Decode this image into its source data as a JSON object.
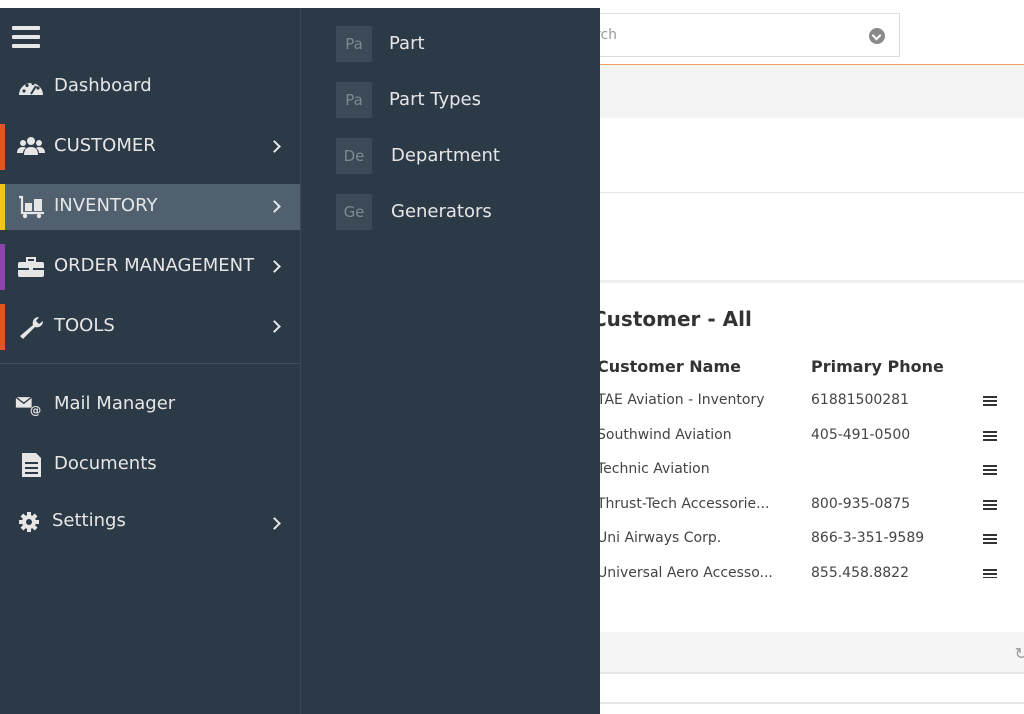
{
  "search": {
    "placeholder": "rch"
  },
  "panel": {
    "title": "Customer - All",
    "columns": [
      "Customer Name",
      "Primary Phone"
    ],
    "rows": [
      {
        "name": "TAE Aviation - Inventory",
        "phone": "61881500281"
      },
      {
        "name": "Southwind Aviation",
        "phone": "405-491-0500"
      },
      {
        "name": "Technic Aviation",
        "phone": ""
      },
      {
        "name": "Thrust-Tech Accessorie...",
        "phone": "800-935-0875"
      },
      {
        "name": "Uni Airways Corp.",
        "phone": "866-3-351-9589"
      },
      {
        "name": "Universal Aero Accesso...",
        "phone": "855.458.8822"
      }
    ]
  },
  "sidebar": {
    "items": [
      {
        "label": "Dashboard",
        "icon": "dashboard-gauge-icon",
        "accent": "",
        "chevron": false
      },
      {
        "label": "CUSTOMER",
        "icon": "users-icon",
        "accent": "#e0552a",
        "chevron": true
      },
      {
        "label": "INVENTORY",
        "icon": "dolly-cart-icon",
        "accent": "#f0c419",
        "chevron": true
      },
      {
        "label": "ORDER MANAGEMENT",
        "icon": "briefcase-icon",
        "accent": "#8e44ad",
        "chevron": true
      },
      {
        "label": "TOOLS",
        "icon": "wrench-icon",
        "accent": "#e0552a",
        "chevron": true
      },
      {
        "label": "Mail Manager",
        "icon": "mail-at-icon",
        "accent": "",
        "chevron": false
      },
      {
        "label": "Documents",
        "icon": "document-icon",
        "accent": "",
        "chevron": false
      },
      {
        "label": "Settings",
        "icon": "gear-icon",
        "accent": "",
        "chevron": true
      }
    ],
    "active_item": "INVENTORY"
  },
  "submenu": {
    "items": [
      {
        "abbr": "Pa",
        "label": "Part"
      },
      {
        "abbr": "Pa",
        "label": "Part Types"
      },
      {
        "abbr": "De",
        "label": "Department"
      },
      {
        "abbr": "Ge",
        "label": "Generators"
      }
    ]
  },
  "colors": {
    "sidebar_bg": "#2c3a47",
    "active_bg": "#51606f",
    "accent_customer": "#e0552a",
    "accent_inventory": "#f0c419",
    "accent_order": "#8e44ad",
    "accent_tools": "#e0552a"
  }
}
